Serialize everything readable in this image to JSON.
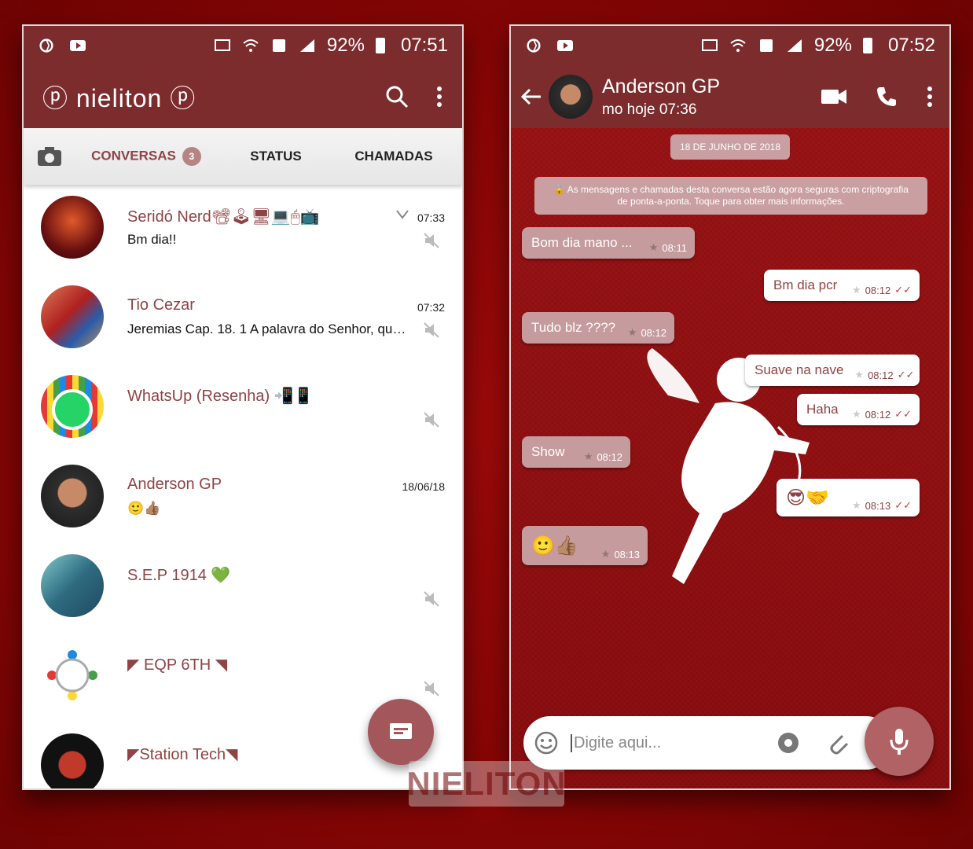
{
  "left_phone": {
    "status": {
      "battery": "92%",
      "time": "07:51"
    },
    "app_title": "ⓟ nieliton ⓟ",
    "tabs": {
      "chats": "CONVERSAS",
      "badge": "3",
      "status": "STATUS",
      "calls": "CHAMADAS"
    },
    "chats": [
      {
        "name": "Seridó Nerd📽🕹🖥💻🖱📺",
        "message": "Bm dia!!",
        "time": "07:33",
        "muted": true
      },
      {
        "name": "Tio Cezar",
        "message": "Jeremias Cap. 18. 1 A palavra do Senhor, que...",
        "time": "07:32",
        "muted": true
      },
      {
        "name": "WhatsUp (Resenha) 📲📱",
        "message": "",
        "time": "",
        "muted": true
      },
      {
        "name": "Anderson GP",
        "message": "🙂👍🏽",
        "time": "18/06/18",
        "muted": false
      },
      {
        "name": "S.E.P 1914 💚",
        "message": "",
        "time": "",
        "muted": true
      },
      {
        "name": "◤ EQP 6TH ◥",
        "message": "",
        "time": "",
        "muted": true
      },
      {
        "name": "◤Station Tech◥",
        "message": "",
        "time": "",
        "muted": true
      }
    ]
  },
  "right_phone": {
    "status": {
      "battery": "92%",
      "time": "07:52"
    },
    "contact": {
      "name": "Anderson GP",
      "last_seen": "mo hoje 07:36"
    },
    "date_chip": "18 DE JUNHO DE 2018",
    "encryption_note": "🔒 As mensagens e chamadas desta conversa estão agora seguras com criptografia de ponta-a-ponta. Toque para obter mais informações.",
    "messages": [
      {
        "dir": "in",
        "text": "Bom dia mano ...",
        "time": "08:11"
      },
      {
        "dir": "out",
        "text": "Bm dia pcr",
        "time": "08:12"
      },
      {
        "dir": "in",
        "text": "Tudo blz ????",
        "time": "08:12"
      },
      {
        "dir": "out",
        "text": "Suave na nave",
        "time": "08:12"
      },
      {
        "dir": "out",
        "text": "Haha",
        "time": "08:12"
      },
      {
        "dir": "in",
        "text": "Show",
        "time": "08:12"
      },
      {
        "dir": "out",
        "text": "😎🤝",
        "time": "08:13"
      },
      {
        "dir": "in",
        "text": "🙂👍🏽",
        "time": "08:13"
      }
    ],
    "composer_placeholder": "Digite aqui..."
  },
  "watermark": "NIELITON",
  "colors": {
    "primary": "#7d2c2e",
    "accent": "#8f4345",
    "bubble_in": "#c59b9d",
    "background": "#8a0606"
  }
}
